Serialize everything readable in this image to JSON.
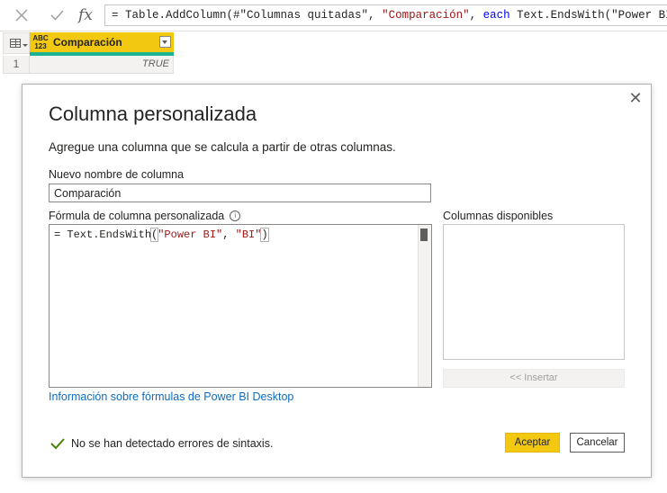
{
  "formula_bar": {
    "cancel_icon": "x-icon",
    "commit_icon": "check-icon",
    "fx_label": "fx",
    "formula_parts": {
      "p1": "= Table.AddColumn(#\"Columnas quitadas\", ",
      "p2": "\"Comparación\"",
      "p3": ", ",
      "p4": "each",
      "p5": " Text.EndsWith(\"Power BI\", \"BI\"))"
    }
  },
  "grid": {
    "type_icon_top": "ABC",
    "type_icon_bottom": "123",
    "column_name": "Comparación",
    "rows": [
      {
        "num": "1",
        "value": "TRUE"
      }
    ]
  },
  "dialog": {
    "title": "Columna personalizada",
    "description": "Agregue una columna que se calcula a partir de otras columnas.",
    "name_label": "Nuevo nombre de columna",
    "name_value": "Comparación",
    "formula_label": "Fórmula de columna personalizada",
    "formula_info_icon": "i",
    "formula_parts": {
      "a": "= Text.EndsWith",
      "b": "(",
      "c": "\"Power BI\"",
      "d": ", ",
      "e": "\"BI\"",
      "f": ")"
    },
    "available_label": "Columnas disponibles",
    "insert_label": "<< Insertar",
    "help_link": "Información sobre fórmulas de Power BI Desktop",
    "status_text": "No se han detectado errores de sintaxis.",
    "ok_label": "Aceptar",
    "cancel_label": "Cancelar",
    "close_symbol": "✕"
  },
  "colors": {
    "accent_yellow": "#f2c811",
    "quality_green": "#1ab394",
    "link_blue": "#0f6cbd",
    "check_green": "#498205",
    "string_red": "#a31515",
    "keyword_blue": "#0000ff"
  }
}
